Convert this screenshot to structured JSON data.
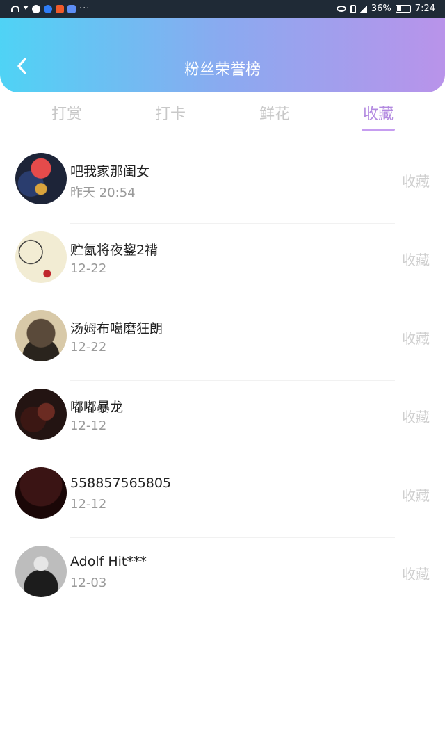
{
  "status_bar": {
    "more": "···",
    "battery": "36%",
    "battery_level": 0.36,
    "time": "7:24"
  },
  "header": {
    "title": "粉丝荣誉榜"
  },
  "tabs": [
    {
      "label": "打赏",
      "active": false
    },
    {
      "label": "打卡",
      "active": false
    },
    {
      "label": "鲜花",
      "active": false
    },
    {
      "label": "收藏",
      "active": true
    }
  ],
  "list": [
    {
      "name": "吧我家那闺女",
      "date": "昨天 20:54",
      "action": "收藏"
    },
    {
      "name": "贮氤将夜鋆2褙",
      "date": "12-22",
      "action": "收藏"
    },
    {
      "name": "汤姆布噶磨狂朗",
      "date": "12-22",
      "action": "收藏"
    },
    {
      "name": "嘟嘟暴龙",
      "date": "12-12",
      "action": "收藏"
    },
    {
      "name": "558857565805",
      "date": "12-12",
      "action": "收藏"
    },
    {
      "name": "Adolf Hit***",
      "date": "12-03",
      "action": "收藏"
    }
  ],
  "colors": {
    "gradient_start": "#4fd3f5",
    "gradient_end": "#b993ea",
    "tab_active": "#b38ae0",
    "tab_inactive": "#c8c8c8",
    "action": "#cfcfcf"
  }
}
